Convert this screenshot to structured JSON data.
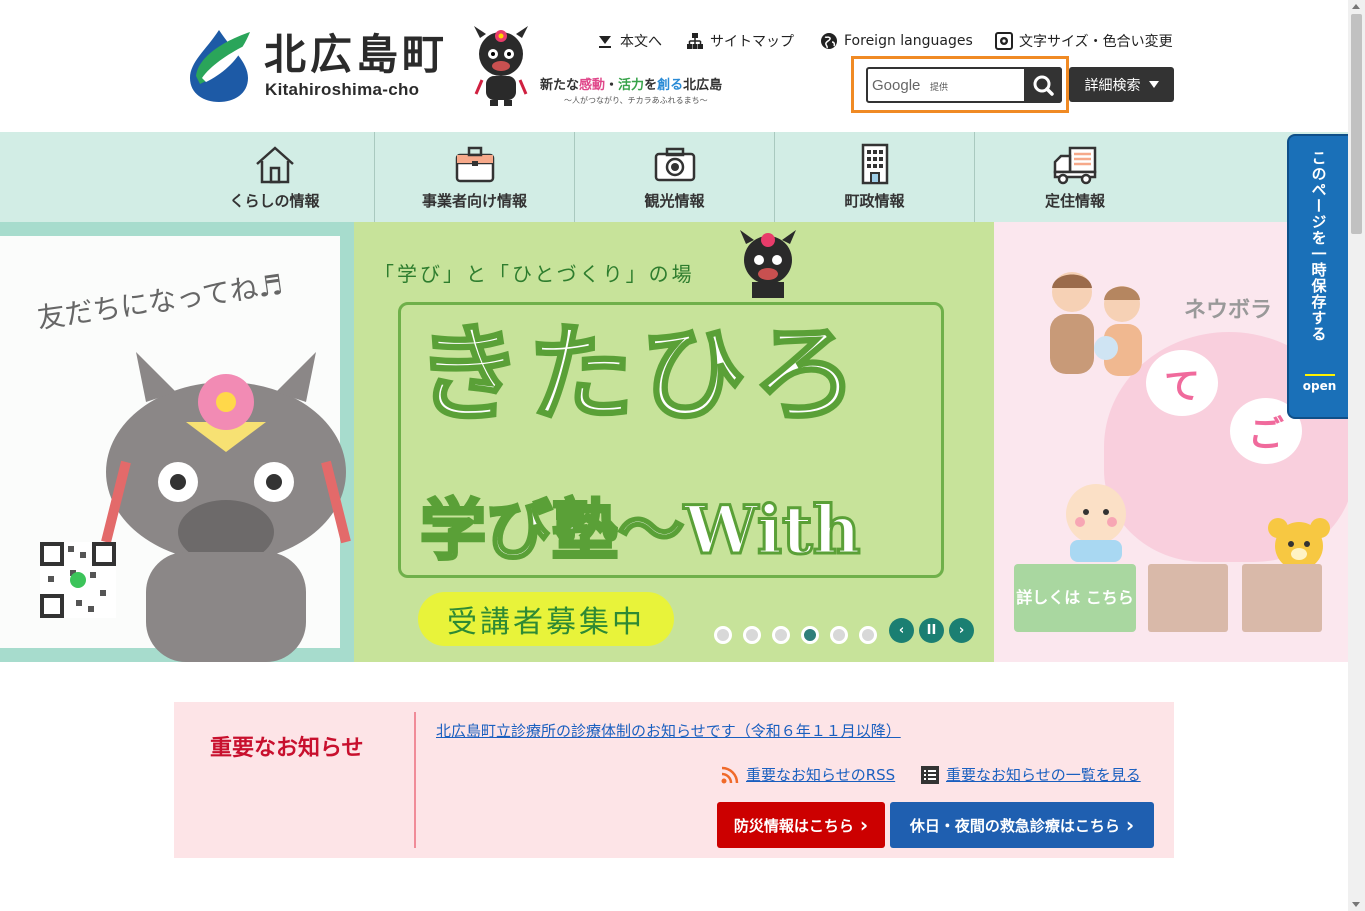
{
  "header": {
    "logo_jp": "北広島町",
    "logo_en": "Kitahiroshima-cho",
    "slogan_prefix": "新たな",
    "slogan_pink": "感動",
    "slogan_dot": "・",
    "slogan_green": "活力",
    "slogan_mid": "を",
    "slogan_blue": "創る",
    "slogan_suffix": "北広島",
    "slogan_sub": "〜人がつながり、チカラあふれるまち〜",
    "util": {
      "main_content": "本文へ",
      "sitemap": "サイトマップ",
      "foreign": "Foreign languages",
      "text_size": "文字サイズ・色合い変更"
    },
    "search": {
      "placeholder": "Google",
      "provider": "提供",
      "advanced_label": "詳細検索"
    }
  },
  "nav": {
    "items": [
      {
        "label": "くらしの情報",
        "icon": "house-icon"
      },
      {
        "label": "事業者向け情報",
        "icon": "briefcase-icon"
      },
      {
        "label": "観光情報",
        "icon": "camera-icon"
      },
      {
        "label": "町政情報",
        "icon": "building-icon"
      },
      {
        "label": "定住情報",
        "icon": "truck-icon"
      }
    ]
  },
  "side_tab": {
    "text": "このページを一時保存する",
    "open": "open"
  },
  "slider": {
    "left_text": "友だちになってね♬",
    "center_top": "「学び」と「ひとづくり」の場",
    "center_title": "きたひろ",
    "center_sub": "学び塾〜With",
    "center_pill": "受講者募集中",
    "right_text": "ネウボラ",
    "right_te": "て",
    "right_go": "ご",
    "right_cart": "詳しくは こちら",
    "dots_count": 6,
    "active_dot": 4,
    "prev": "‹",
    "pause": "II",
    "next": "›"
  },
  "notice": {
    "title": "重要なお知らせ",
    "link": "北広島町立診療所の診療体制のお知らせです（令和６年１１月以降）",
    "rss": "重要なお知らせのRSS",
    "list": "重要なお知らせの一覧を見る",
    "disaster_btn": "防災情報はこちら",
    "emergency_btn": "休日・夜間の救急診療はこちら"
  },
  "colors": {
    "nav_bg": "#d2ede5",
    "side_tab": "#1a70b8",
    "notice_bg": "#fde4e7",
    "notice_title": "#c8102e",
    "disaster": "#cc0000",
    "emergency": "#1f5fb0",
    "search_highlight": "#f08a24"
  }
}
